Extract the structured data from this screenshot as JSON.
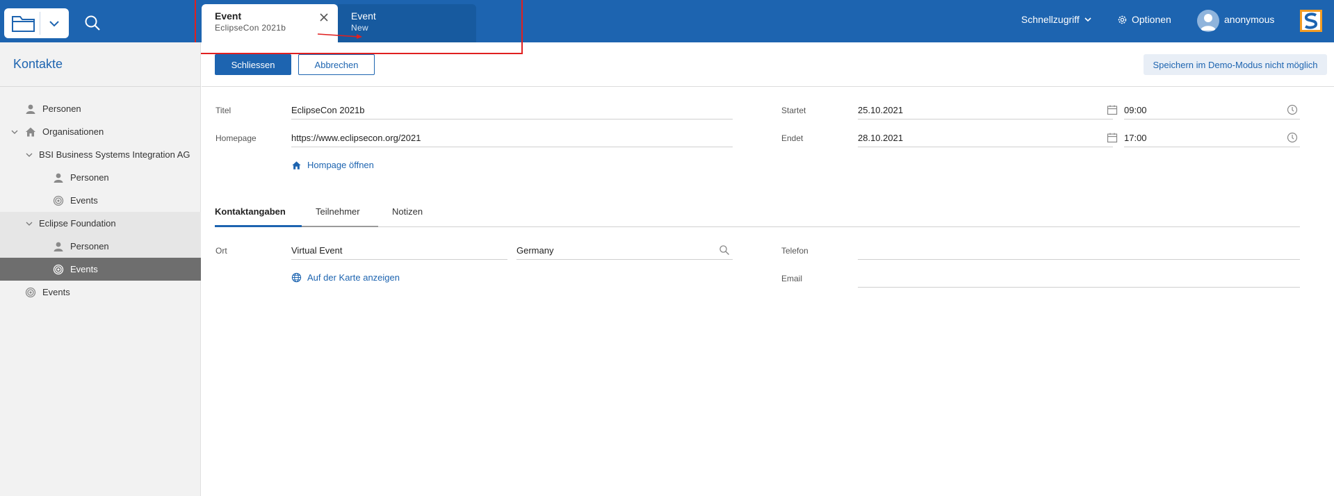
{
  "header": {
    "tabs": [
      {
        "title": "Event",
        "subtitle": "EclipseCon 2021b"
      },
      {
        "title": "Event",
        "subtitle": "New"
      }
    ],
    "quick_access": "Schnellzugriff",
    "options": "Optionen",
    "user": "anonymous"
  },
  "sidebar": {
    "title": "Kontakte",
    "items": [
      {
        "label": "Personen"
      },
      {
        "label": "Organisationen"
      },
      {
        "label": "BSI Business Systems Integration AG"
      },
      {
        "label": "Personen"
      },
      {
        "label": "Events"
      },
      {
        "label": "Eclipse Foundation"
      },
      {
        "label": "Personen"
      },
      {
        "label": "Events"
      },
      {
        "label": "Events"
      }
    ]
  },
  "toolbar": {
    "close_label": "Schliessen",
    "cancel_label": "Abbrechen",
    "demo_note": "Speichern im Demo-Modus nicht möglich"
  },
  "form": {
    "title_label": "Titel",
    "title_value": "EclipseCon 2021b",
    "homepage_label": "Homepage",
    "homepage_value": "https://www.eclipsecon.org/2021",
    "homepage_link": "Hompage öffnen",
    "start_label": "Startet",
    "start_date": "25.10.2021",
    "start_time": "09:00",
    "end_label": "Endet",
    "end_date": "28.10.2021",
    "end_time": "17:00"
  },
  "subtabs": [
    "Kontaktangaben",
    "Teilnehmer",
    "Notizen"
  ],
  "contact": {
    "place_label": "Ort",
    "place_value": "Virtual Event",
    "country_value": "Germany",
    "map_link": "Auf der Karte anzeigen",
    "phone_label": "Telefon",
    "phone_value": "",
    "email_label": "Email",
    "email_value": ""
  },
  "colors": {
    "brand": "#1d64b0",
    "selected_row": "#6e6e6e",
    "highlight": "#e02020"
  }
}
